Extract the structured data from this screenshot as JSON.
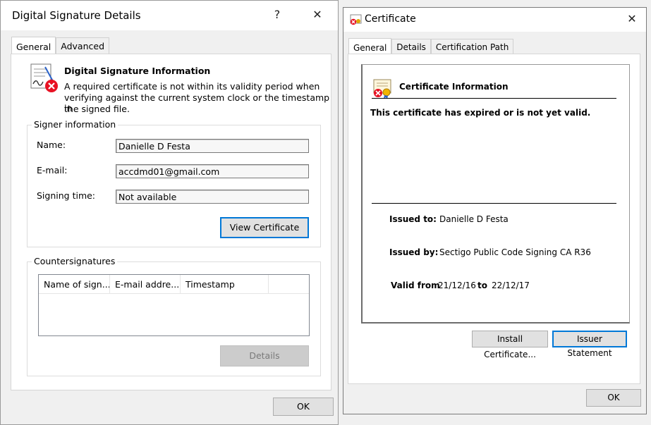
{
  "sig_dialog": {
    "title": "Digital Signature Details",
    "help_glyph": "?",
    "close_glyph": "✕",
    "tabs": [
      "General",
      "Advanced"
    ],
    "info_heading": "Digital Signature Information",
    "info_text_line1": "A required certificate is not within its validity period when",
    "info_text_line2": "verifying against the current system clock or the timestamp in",
    "info_text_line3": "the signed file.",
    "signer_group": "Signer information",
    "name_label": "Name:",
    "name_value": "Danielle D Festa",
    "email_label": "E-mail:",
    "email_value": "accdmd01@gmail.com",
    "signing_time_label": "Signing time:",
    "signing_time_value": "Not available",
    "view_certificate_label": "View Certificate",
    "countersig_group": "Countersignatures",
    "countersig_columns": [
      "Name of sign...",
      "E-mail addre...",
      "Timestamp"
    ],
    "details_label": "Details",
    "ok_label": "OK",
    "icon": "signature-error-icon"
  },
  "cert_dialog": {
    "title": "Certificate",
    "close_glyph": "✕",
    "tabs": [
      "General",
      "Details",
      "Certification Path"
    ],
    "info_heading": "Certificate Information",
    "status_text": "This certificate has expired or is not yet valid.",
    "issued_to_label": "Issued to:",
    "issued_to_value": "Danielle D Festa",
    "issued_by_label": "Issued by:",
    "issued_by_value": "Sectigo Public Code Signing CA R36",
    "valid_from_label": "Valid from",
    "valid_from_value": "21/12/16",
    "valid_to_label": "to",
    "valid_to_value": "22/12/17",
    "install_label": "Install Certificate...",
    "issuer_statement_label": "Issuer Statement",
    "ok_label": "OK",
    "icon": "certificate-error-icon"
  },
  "colors": {
    "focus_blue": "#0078d7",
    "error_red": "#e81123"
  }
}
